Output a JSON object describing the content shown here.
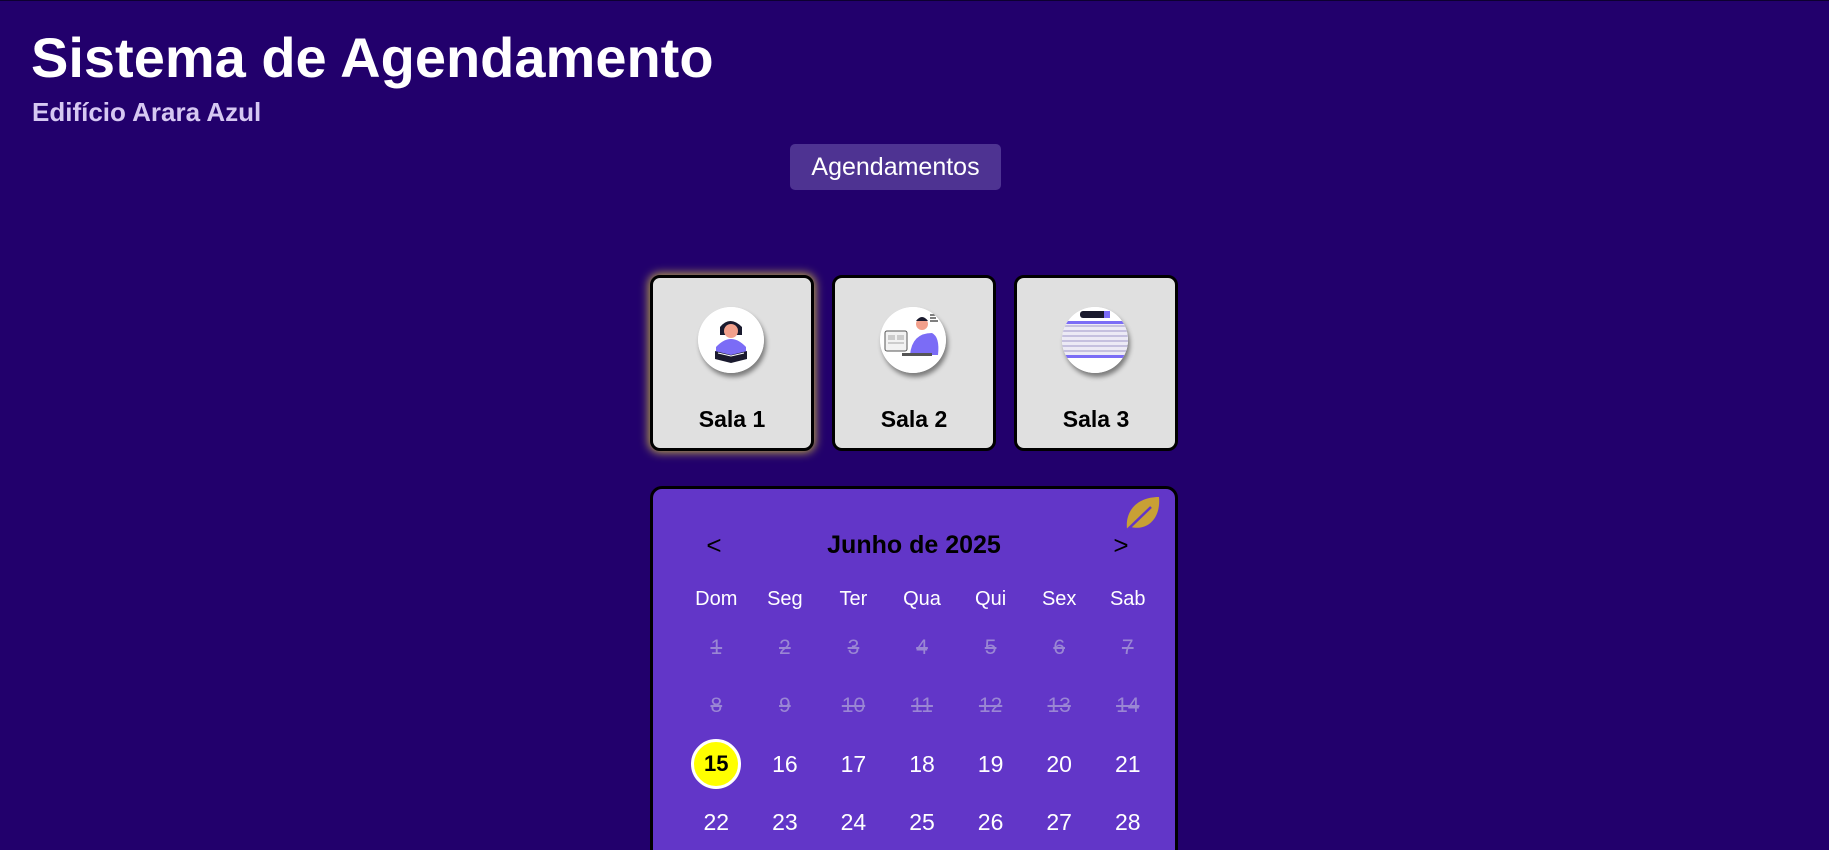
{
  "header": {
    "title": "Sistema de Agendamento",
    "subtitle": "Edifício Arara Azul",
    "nav_button": "Agendamentos"
  },
  "rooms": [
    {
      "label": "Sala 1",
      "icon": "person-reading-icon",
      "selected": true
    },
    {
      "label": "Sala 2",
      "icon": "person-at-computer-icon",
      "selected": false
    },
    {
      "label": "Sala 3",
      "icon": "notebook-pen-icon",
      "selected": false
    }
  ],
  "calendar": {
    "month_label": "Junho de 2025",
    "prev": "<",
    "next": ">",
    "weekdays": [
      "Dom",
      "Seg",
      "Ter",
      "Qua",
      "Qui",
      "Sex",
      "Sab"
    ],
    "weeks": [
      [
        "1",
        "2",
        "3",
        "4",
        "5",
        "6",
        "7"
      ],
      [
        "8",
        "9",
        "10",
        "11",
        "12",
        "13",
        "14"
      ],
      [
        "15",
        "16",
        "17",
        "18",
        "19",
        "20",
        "21"
      ],
      [
        "22",
        "23",
        "24",
        "25",
        "26",
        "27",
        "28"
      ]
    ],
    "disabled_through": 14,
    "today": "15"
  },
  "colors": {
    "background": "#22006c",
    "nav_button": "#4e3392",
    "card": "#e0e0e0",
    "calendar": "#6236c8",
    "today": "#ffff00",
    "leaf": "#c8a035"
  }
}
